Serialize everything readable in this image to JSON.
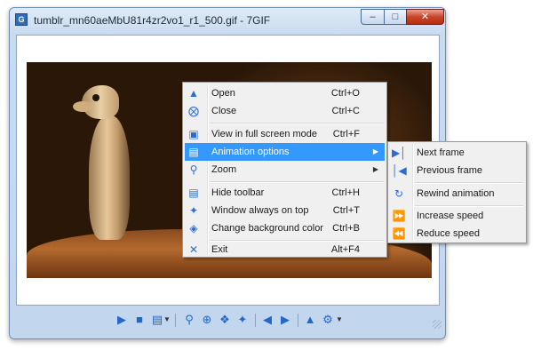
{
  "window": {
    "title": "tumblr_mn60aeMbU81r4zr2vo1_r1_500.gif - 7GIF",
    "min_icon": "minimize-icon",
    "max_icon": "maximize-icon",
    "close_icon": "close-icon"
  },
  "context_menu": {
    "items": [
      {
        "label": "Open",
        "shortcut": "Ctrl+O",
        "icon": "open-folder-icon"
      },
      {
        "label": "Close",
        "shortcut": "Ctrl+C",
        "icon": "close-circle-icon"
      },
      {
        "label": "View in full screen mode",
        "shortcut": "Ctrl+F",
        "icon": "fullscreen-icon"
      },
      {
        "label": "Animation options",
        "shortcut": "",
        "icon": "animation-icon",
        "submenu": true
      },
      {
        "label": "Zoom",
        "shortcut": "",
        "icon": "zoom-icon",
        "submenu": true
      },
      {
        "label": "Hide toolbar",
        "shortcut": "Ctrl+H",
        "icon": "toolbar-icon"
      },
      {
        "label": "Window always on top",
        "shortcut": "Ctrl+T",
        "icon": "pin-icon"
      },
      {
        "label": "Change background color",
        "shortcut": "Ctrl+B",
        "icon": "paint-bucket-icon"
      },
      {
        "label": "Exit",
        "shortcut": "Alt+F4",
        "icon": "exit-x-icon"
      }
    ]
  },
  "animation_submenu": {
    "items": [
      {
        "label": "Next frame",
        "icon": "next-frame-icon"
      },
      {
        "label": "Previous frame",
        "icon": "previous-frame-icon"
      },
      {
        "label": "Rewind animation",
        "icon": "rewind-icon"
      },
      {
        "label": "Increase speed",
        "icon": "fast-forward-icon"
      },
      {
        "label": "Reduce speed",
        "icon": "rewind-speed-icon"
      }
    ]
  },
  "toolbar": {
    "buttons": [
      "play-icon",
      "stop-icon",
      "frames-icon",
      "zoom-out-icon",
      "zoom-in-icon",
      "fit-icon",
      "actual-size-icon",
      "previous-file-icon",
      "next-file-icon",
      "open-icon",
      "settings-icon"
    ]
  },
  "colors": {
    "highlight": "#3399ff",
    "accent": "#2566c8",
    "window_frame": "#c2d6ee"
  }
}
